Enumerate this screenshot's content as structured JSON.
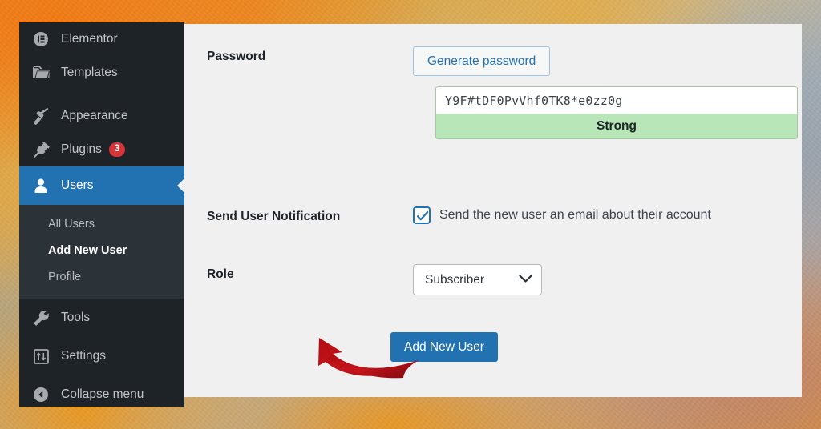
{
  "sidebar": {
    "items": [
      {
        "label": "Elementor",
        "icon": "elementor-icon",
        "state": "default"
      },
      {
        "label": "Templates",
        "icon": "folder-icon",
        "state": "default"
      },
      {
        "label": "Appearance",
        "icon": "paintbrush-icon",
        "state": "default"
      },
      {
        "label": "Plugins",
        "icon": "plug-icon",
        "state": "default",
        "badge": "3"
      },
      {
        "label": "Users",
        "icon": "user-icon",
        "state": "current"
      },
      {
        "label": "Tools",
        "icon": "wrench-icon",
        "state": "default"
      },
      {
        "label": "Settings",
        "icon": "sliders-icon",
        "state": "default"
      },
      {
        "label": "Collapse menu",
        "icon": "collapse-arrow-icon",
        "state": "default"
      }
    ],
    "submenu": [
      {
        "label": "All Users",
        "active": false
      },
      {
        "label": "Add New User",
        "active": true
      },
      {
        "label": "Profile",
        "active": false
      }
    ],
    "badge_color": "#d63638",
    "current_color": "#2271b1",
    "background": "#1d2327",
    "submenu_background": "#2c3338"
  },
  "form": {
    "password": {
      "label": "Password",
      "generate_button": "Generate password",
      "value": "Y9F#tDF0PvVhf0TK8*e0zz0g",
      "strength": "Strong",
      "strength_color": "#b8e6b8"
    },
    "notification": {
      "label": "Send User Notification",
      "checkbox_label": "Send the new user an email about their account",
      "checked": true
    },
    "role": {
      "label": "Role",
      "value": "Subscriber",
      "chevron": "chevron-down-icon"
    },
    "submit_button": "Add New User"
  },
  "annotation": {
    "arrow": "red-curved-arrow",
    "color": "#c1121c",
    "points_to": "Add New User"
  },
  "panel": {
    "background": "#f0f0f1"
  }
}
